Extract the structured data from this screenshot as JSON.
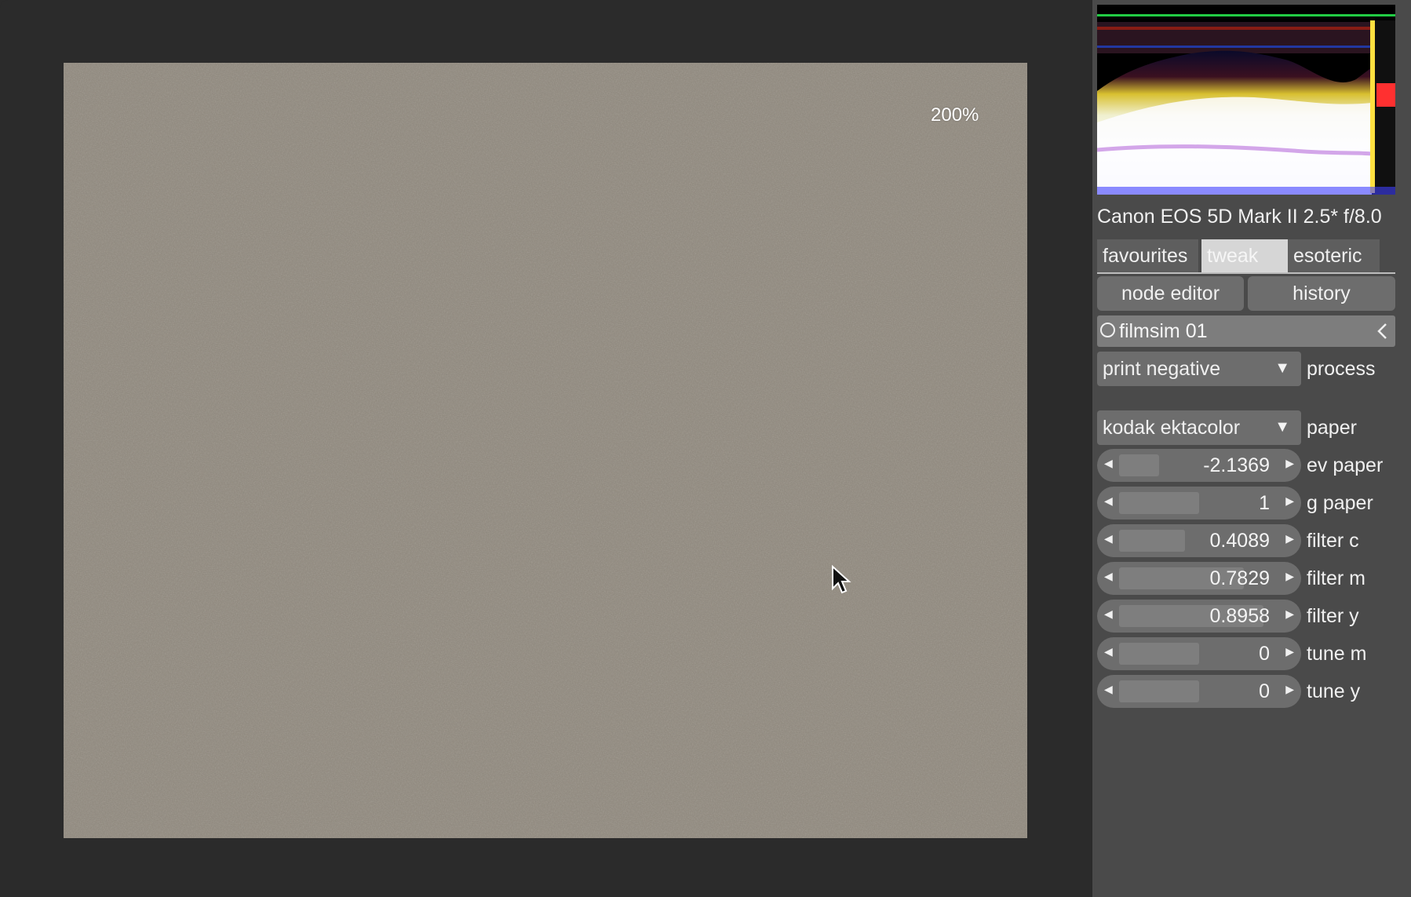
{
  "viewer": {
    "zoom_label": "200%"
  },
  "sidebar": {
    "camera_info": "Canon EOS 5D Mark II 2.5* f/8.0",
    "tabs": [
      {
        "label": "favourites",
        "active": false
      },
      {
        "label": "tweak all",
        "active": true
      },
      {
        "label": "esoteric",
        "active": false
      }
    ],
    "buttons": {
      "node_editor": "node editor",
      "history": "history"
    },
    "module": {
      "title": "filmsim 01",
      "process": {
        "value": "print negative",
        "label": "process"
      },
      "paper": {
        "value": "kodak ektacolor",
        "label": "paper"
      },
      "params": [
        {
          "label": "ev paper",
          "value": "-2.1369",
          "level": 0.25
        },
        {
          "label": "g paper",
          "value": "1",
          "level": 0.5
        },
        {
          "label": "filter c",
          "value": "0.4089",
          "level": 0.41
        },
        {
          "label": "filter m",
          "value": "0.7829",
          "level": 0.78
        },
        {
          "label": "filter y",
          "value": "0.8958",
          "level": 0.9
        },
        {
          "label": "tune m",
          "value": "0",
          "level": 0.5
        },
        {
          "label": "tune y",
          "value": "0",
          "level": 0.5
        }
      ]
    }
  },
  "colors": {
    "panel_bg": "#4a4a4a",
    "viewer_bg": "#2b2b2b",
    "widget_bg": "#6d6d6d",
    "active_tab": "#d6d6d6"
  },
  "icons": [
    "cursor-icon",
    "module-enable-icon",
    "chevron-left-icon",
    "dropdown-arrow-icon",
    "slider-arrow-left-icon",
    "slider-arrow-right-icon"
  ]
}
